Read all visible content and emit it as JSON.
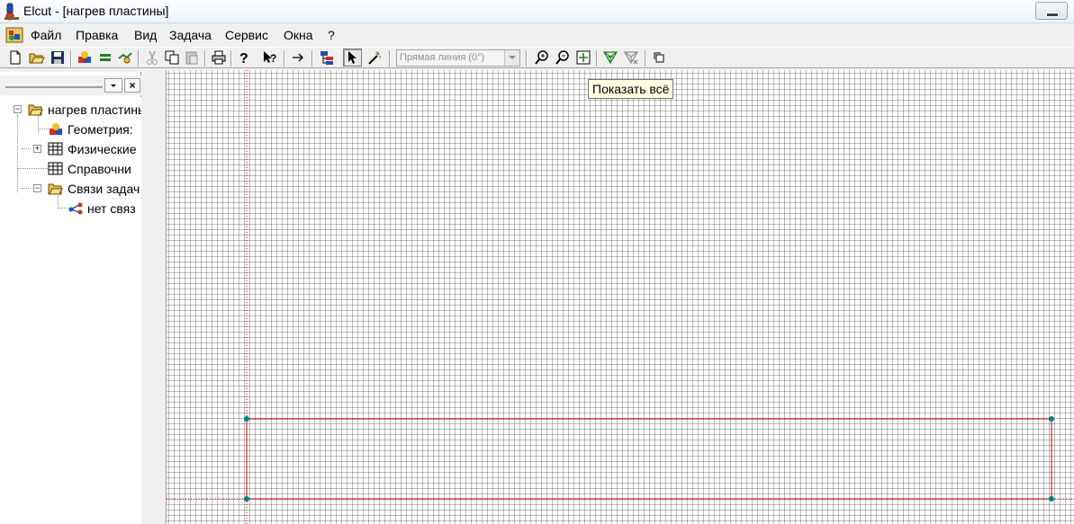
{
  "window": {
    "title": "Elcut - [нагрев пластины]"
  },
  "menu": {
    "items": [
      "Файл",
      "Правка",
      "Вид",
      "Задача",
      "Сервис",
      "Окна",
      "?"
    ]
  },
  "toolbar": {
    "combo_value": "Прямая линия (0°)",
    "icons": [
      "new-icon",
      "open-icon",
      "save-icon",
      "geometry-icon",
      "equal-icon",
      "properties-icon",
      "cut-icon",
      "copy-icon",
      "paste-icon",
      "print-icon",
      "help-icon",
      "context-help-icon",
      "arrow-right-icon",
      "tree-icon",
      "select-pointer-icon",
      "magic-wand-icon",
      "zoom-in-icon",
      "zoom-out-icon",
      "zoom-fit-icon",
      "mesh-icon",
      "remove-mesh-icon",
      "window-icon"
    ],
    "tooltip": "Показать всё"
  },
  "tree": {
    "items": [
      {
        "label": "нагрев пластины",
        "icon": "folder-open-icon"
      },
      {
        "label": "Геометрия:",
        "icon": "geometry-shapes-icon"
      },
      {
        "label": "Физические",
        "icon": "table-icon"
      },
      {
        "label": "Справочни",
        "icon": "table-icon"
      },
      {
        "label": "Связи задач",
        "icon": "folder-open-icon"
      },
      {
        "label": "нет связ",
        "icon": "link-icon"
      }
    ]
  },
  "colors": {
    "geometry_edge": "#cc0000",
    "geometry_vertex": "#008080",
    "axis": "#cc0000"
  }
}
